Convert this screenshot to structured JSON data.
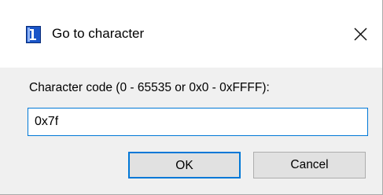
{
  "dialog": {
    "title": "Go to character",
    "close_icon": "close-icon",
    "app_icon": "character-map-icon"
  },
  "form": {
    "label": "Character code (0 - 65535 or 0x0 - 0xFFFF):",
    "code_value": "0x7f"
  },
  "buttons": {
    "ok_label": "OK",
    "cancel_label": "Cancel"
  },
  "colors": {
    "accent": "#0078d7",
    "dialog_background": "#f0f0f0",
    "button_face": "#e1e1e1"
  }
}
